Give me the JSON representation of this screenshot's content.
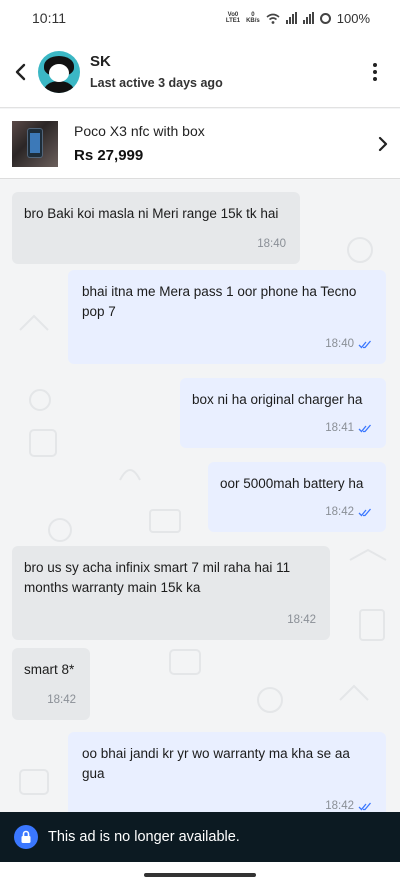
{
  "status_bar": {
    "time": "10:11",
    "volte_top": "Vo0",
    "volte_bottom": "LTE1",
    "speed_top": "0",
    "speed_bottom": "KB/s",
    "battery": "100%"
  },
  "header": {
    "name": "SK",
    "last_active": "Last active 3 days ago"
  },
  "ad": {
    "title": "Poco X3 nfc with box",
    "price": "Rs 27,999"
  },
  "messages": [
    {
      "direction": "in",
      "text": "bro Baki koi masla ni Meri range 15k tk hai",
      "time": "18:40"
    },
    {
      "direction": "out",
      "text": "bhai itna me Mera pass 1 oor phone ha Tecno pop 7",
      "time": "18:40",
      "read": true
    },
    {
      "direction": "out",
      "text": "box ni ha original charger ha",
      "time": "18:41",
      "read": true
    },
    {
      "direction": "out",
      "text": "oor 5000mah battery ha",
      "time": "18:42",
      "read": true
    },
    {
      "direction": "in",
      "text": "bro us sy acha infinix smart 7 mil raha hai 11 months warranty main 15k ka",
      "time": "18:42"
    },
    {
      "direction": "in",
      "text": "smart 8*",
      "time": "18:42"
    },
    {
      "direction": "out",
      "text": "oo bhai jandi kr yr wo warranty ma kha se aa gua",
      "time": "18:42",
      "read": true
    }
  ],
  "banner": {
    "text": "This ad is no longer available."
  },
  "colors": {
    "incoming_bubble": "#e6e8ea",
    "outgoing_bubble": "#e9efff",
    "read_tick": "#3a77ff",
    "banner_bg": "#0c1a22",
    "lock_accent": "#3a77ff"
  },
  "icons": [
    "back-arrow-icon",
    "more-vertical-icon",
    "chevron-right-icon",
    "double-tick-icon",
    "lock-icon",
    "wifi-icon",
    "signal-icon"
  ]
}
